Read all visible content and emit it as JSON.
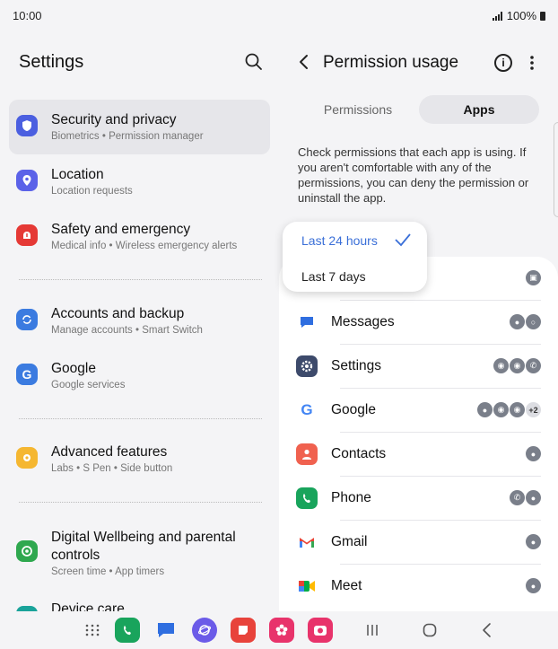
{
  "status_bar": {
    "time": "10:00",
    "battery": "100%"
  },
  "left": {
    "title": "Settings",
    "items": [
      {
        "title": "Security and privacy",
        "sub": "Biometrics  •  Permission manager",
        "icon": "shield-icon",
        "color": "#4b5fe0",
        "active": true
      },
      {
        "title": "Location",
        "sub": "Location requests",
        "icon": "location-pin-icon",
        "color": "#5b62e8"
      },
      {
        "title": "Safety and emergency",
        "sub": "Medical info  •  Wireless emergency alerts",
        "icon": "alert-icon",
        "color": "#e53935"
      },
      {
        "title": "Accounts and backup",
        "sub": "Manage accounts  •  Smart Switch",
        "icon": "sync-icon",
        "color": "#3b7be0"
      },
      {
        "title": "Google",
        "sub": "Google services",
        "icon": "google-icon",
        "color": "#3b7be0"
      },
      {
        "title": "Advanced features",
        "sub": "Labs  •  S Pen  •  Side button",
        "icon": "star-gear-icon",
        "color": "#f5b731"
      },
      {
        "title": "Digital Wellbeing and parental controls",
        "sub": "Screen time  •  App timers",
        "icon": "wellbeing-icon",
        "color": "#2fa84f"
      },
      {
        "title": "Device care",
        "icon": "device-care-icon",
        "color": "#1aa39a"
      }
    ]
  },
  "right": {
    "title": "Permission usage",
    "tabs": [
      "Permissions",
      "Apps"
    ],
    "description": "Check permissions that each app is using. If you aren't comfortable with any of the permissions, you can deny the permission or uninstall the app.",
    "dropdown": {
      "selected": "Last 24 hours",
      "other": "Last 7 days"
    },
    "apps": [
      {
        "name": "",
        "icon": "camera-app-icon",
        "color": "#e8336b",
        "perms": [
          "camera"
        ]
      },
      {
        "name": "Messages",
        "icon": "messages-icon",
        "color": "#2f6ee0",
        "perms": [
          "contacts",
          "sms"
        ]
      },
      {
        "name": "Settings",
        "icon": "settings-gear-icon",
        "color": "#3d4a6b",
        "perms": [
          "location",
          "location",
          "phone"
        ]
      },
      {
        "name": "Google",
        "icon": "google-icon",
        "color": "#ffffff",
        "perms": [
          "contacts",
          "location",
          "location"
        ],
        "more": "+2"
      },
      {
        "name": "Contacts",
        "icon": "contacts-icon",
        "color": "#f0614f",
        "perms": [
          "contacts"
        ]
      },
      {
        "name": "Phone",
        "icon": "phone-icon",
        "color": "#19a45c",
        "perms": [
          "call-log",
          "contacts"
        ]
      },
      {
        "name": "Gmail",
        "icon": "gmail-icon",
        "color": "#ffffff",
        "perms": [
          "contacts"
        ]
      },
      {
        "name": "Meet",
        "icon": "meet-icon",
        "color": "#ffffff",
        "perms": [
          "contacts"
        ]
      }
    ]
  },
  "dock": {
    "apps": [
      {
        "name": "phone-app-icon",
        "color": "#19a45c"
      },
      {
        "name": "messages-app-icon",
        "color": "#2f6ee0"
      },
      {
        "name": "internet-app-icon",
        "color": "#6b5be8"
      },
      {
        "name": "notes-app-icon",
        "color": "#e8433b"
      },
      {
        "name": "gallery-app-icon",
        "color": "#e8336b"
      },
      {
        "name": "camera-app-icon",
        "color": "#e8336b"
      }
    ]
  }
}
